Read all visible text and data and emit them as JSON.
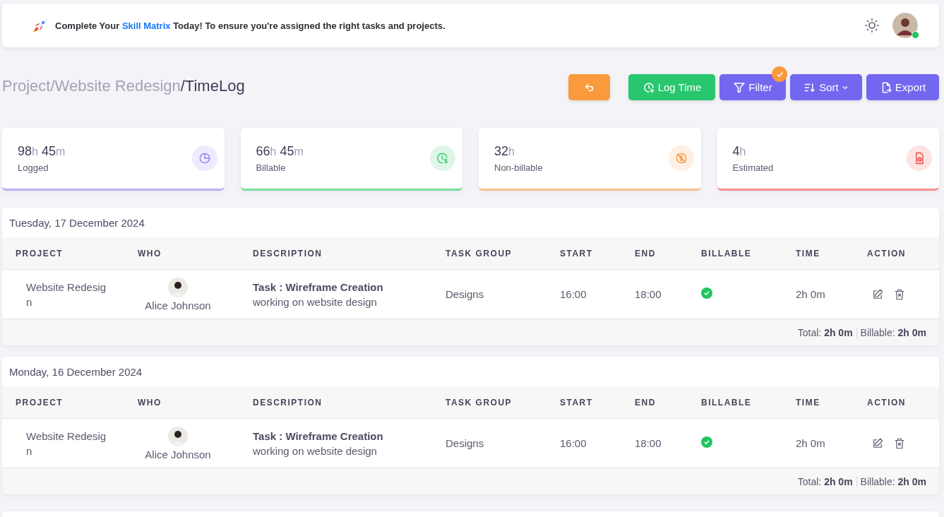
{
  "banner": {
    "before": "Complete Your ",
    "link": "Skill Matrix",
    "after": " Today! To ensure you're assigned the right tasks and projects.",
    "user_online": true
  },
  "breadcrumb": {
    "separator": "/",
    "items": [
      {
        "label": "Project",
        "current": false
      },
      {
        "label": "Website Redesign",
        "current": false
      },
      {
        "label": "TimeLog",
        "current": true
      }
    ]
  },
  "toolbar": [
    {
      "kind": "back"
    },
    {
      "kind": "log",
      "label": "Log Time"
    },
    {
      "kind": "filter",
      "label": "Filter",
      "applied": true
    },
    {
      "kind": "sort",
      "label": "Sort"
    },
    {
      "kind": "export",
      "label": "Export"
    }
  ],
  "stats": [
    {
      "kind": "logged",
      "parts": [
        {
          "n": "98",
          "u": "h"
        },
        {
          "n": "45",
          "u": "m"
        }
      ],
      "label": "Logged",
      "color": "#8b7cf6"
    },
    {
      "kind": "billable",
      "parts": [
        {
          "n": "66",
          "u": "h"
        },
        {
          "n": "45",
          "u": "m"
        }
      ],
      "label": "Billable",
      "color": "#22c55e"
    },
    {
      "kind": "nonbillable",
      "parts": [
        {
          "n": "32",
          "u": "h"
        }
      ],
      "label": "Non-billable",
      "color": "#fb923c"
    },
    {
      "kind": "estimated",
      "parts": [
        {
          "n": "4",
          "u": "h"
        }
      ],
      "label": "Estimated",
      "color": "#ef4444"
    }
  ],
  "days": [
    {
      "date": "Tuesday, 17 December 2024",
      "columns": [
        "PROJECT",
        "WHO",
        "DESCRIPTION",
        "TASK GROUP",
        "START",
        "END",
        "BILLABLE",
        "TIME",
        "ACTION"
      ],
      "rows": [
        {
          "project": "Website Redesign",
          "who": "Alice Johnson",
          "task": "Task : Wireframe Creation",
          "description": "working on website design",
          "task_group": "Designs",
          "start": "16:00",
          "end": "18:00",
          "billable": true,
          "time": "2h 0m"
        }
      ],
      "total_label": "Total:",
      "total": "2h 0m",
      "billable_label": "Billable:",
      "billable_total": "2h 0m"
    },
    {
      "date": "Monday, 16 December 2024",
      "columns": [
        "PROJECT",
        "WHO",
        "DESCRIPTION",
        "TASK GROUP",
        "START",
        "END",
        "BILLABLE",
        "TIME",
        "ACTION"
      ],
      "rows": [
        {
          "project": "Website Redesign",
          "who": "Alice Johnson",
          "task": "Task : Wireframe Creation",
          "description": "working on website design",
          "task_group": "Designs",
          "start": "16:00",
          "end": "18:00",
          "billable": true,
          "time": "2h 0m"
        }
      ],
      "total_label": "Total:",
      "total": "2h 0m",
      "billable_label": "Billable:",
      "billable_total": "2h 0m"
    }
  ]
}
